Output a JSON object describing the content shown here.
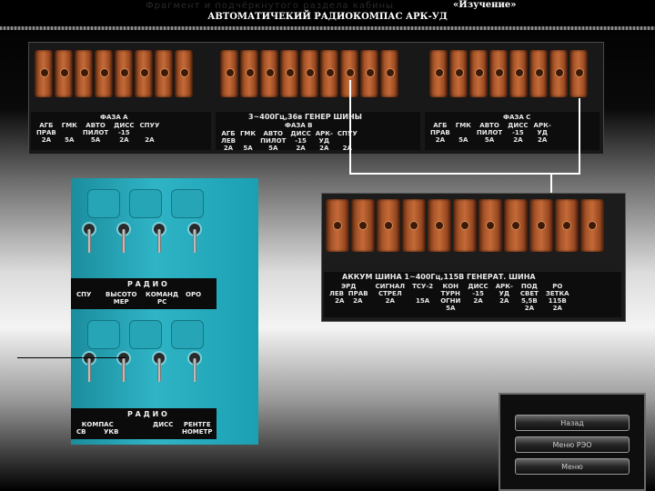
{
  "header": {
    "faint_text": "Фрагмент и подчёркнутого раздела кабины",
    "mode_label": "«Изучение»",
    "title": "АВТОМАТИЧЕКИЙ РАДИОКОМПАС АРК-УД"
  },
  "top_panel": {
    "bus_title": "3~400Гц,36в ГЕНЕР ШИНЫ",
    "phase_a": "ФАЗА А",
    "phase_b": "ФАЗА В",
    "phase_c": "ФАЗА С",
    "left_labels": [
      "АГБ\nПРАВ\n2А",
      "ГМК\n\n5А",
      "АВТО\nПИЛОТ\n5А",
      "ДИСС\n-15\n2А",
      "СПУУ\n\n2А"
    ],
    "mid_labels": [
      "АГБ\nЛЕВ\n2А",
      "ГМК\n\n5А",
      "АВТО\nПИЛОТ\n5А",
      "ДИСС\n-15\n2А",
      "АРК-\nУД\n2А",
      "СПУУ\n\n2А"
    ],
    "right_labels": [
      "АГБ\nПРАВ\n2А",
      "ГМК\n\n5А",
      "АВТО\nПИЛОТ\n5А",
      "ДИСС\n-15\n2А",
      "АРК-\nУД\n2А"
    ]
  },
  "radio_panel": {
    "block1_title": "Р А Д И О",
    "block1_labels": [
      "СПУ",
      "ВЫСОТО\nМЕР",
      "КОМАНД\nРС",
      "ОРО"
    ],
    "block2_title": "Р А Д И О",
    "block2_labels": [
      "КОМПАС\nСВ        УКВ",
      "ДИСС",
      "РЕНТГЕ\nНОМЕТР"
    ]
  },
  "enlarged_panel": {
    "bus_title": "АККУМ ШИНА     1~400Гц,115В ГЕНЕРАТ. ШИНА",
    "labels": [
      "ЭРД\nЛЕВ  ПРАВ\n2А    2А",
      "СИГНАЛ\nСТРЕЛ\n2А",
      "ТСУ-2\n\n15А",
      "КОН\nТУРН\nОГНИ\n5А",
      "ДИСС\n-15\n2А",
      "АРК-\nУД\n2А",
      "ПОД\nСВЕТ\n5,5В\n2А",
      "РО\nЗЕТКА\n115В\n2А"
    ]
  },
  "nav": {
    "btn1": "Назад",
    "btn2": "Меню РЭО",
    "btn3": "Меню"
  },
  "colors": {
    "fuse": "#b05a2c",
    "panel_turquoise": "#2fb4c6",
    "connector": "#ffffff"
  }
}
